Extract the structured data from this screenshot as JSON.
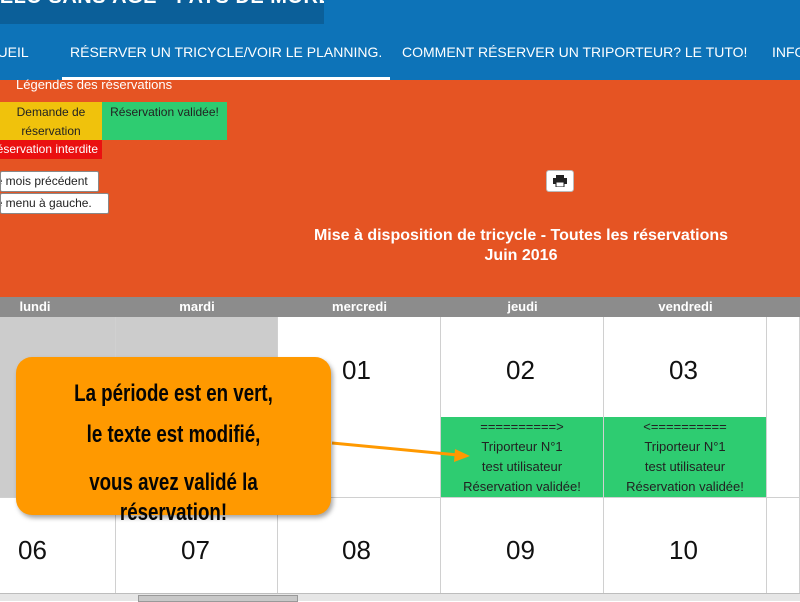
{
  "site": {
    "title": "VÉLO SANS ÂGE - PAYS DE MORLAIX"
  },
  "nav": {
    "items": [
      {
        "label": "ACCUEIL"
      },
      {
        "label": "RÉSERVER UN TRICYCLE/VOIR LE PLANNING."
      },
      {
        "label": "COMMENT RÉSERVER UN TRIPORTEUR? LE TUTO!"
      },
      {
        "label": "INFO"
      }
    ]
  },
  "legend": {
    "title": "Légendes des réservations",
    "pending": "Demande de réservation",
    "validated": "Réservation validée!",
    "forbidden": "Réservation interdite"
  },
  "controls": {
    "prev_month": "Le mois précédent",
    "left_menu": "Le menu à gauche."
  },
  "calendar": {
    "title": "Mise à disposition de tricycle - Toutes les réservations",
    "month": "Juin 2016",
    "days": [
      "lundi",
      "mardi",
      "mercredi",
      "jeudi",
      "vendredi"
    ],
    "week1": [
      "",
      "",
      "01",
      "02",
      "03"
    ],
    "week2": [
      "06",
      "07",
      "08",
      "09",
      "10"
    ],
    "reservations": [
      {
        "arrow": "==========>",
        "vehicle": "Triporteur N°1",
        "user": "test utilisateur",
        "status": "Réservation validée!"
      },
      {
        "arrow": "<==========",
        "vehicle": "Triporteur N°1",
        "user": "test utilisateur",
        "status": "Réservation validée!"
      }
    ]
  },
  "callout": {
    "lines": [
      "La période est en vert,",
      "le texte est modifié,",
      "vous avez validé la réservation!"
    ]
  },
  "colors": {
    "header_blue": "#0d73b8",
    "calendar_orange": "#e55423",
    "validated_green": "#2ecc71",
    "pending_yellow": "#f0c20c",
    "forbidden_red": "#ea1010",
    "callout_orange": "#ff9900"
  },
  "icons": {
    "print": "print-icon"
  }
}
